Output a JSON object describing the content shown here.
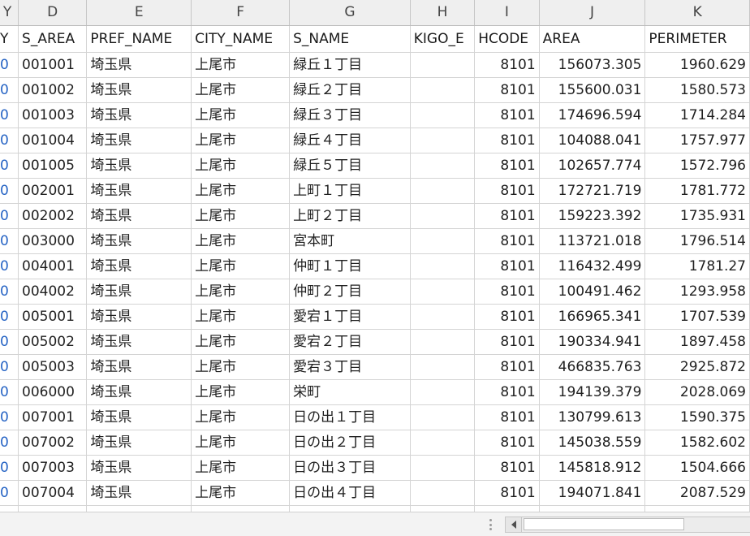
{
  "column_letters": [
    "Y",
    "D",
    "E",
    "F",
    "G",
    "H",
    "I",
    "J",
    "K"
  ],
  "field_headers": [
    "Y",
    "S_AREA",
    "PREF_NAME",
    "CITY_NAME",
    "S_NAME",
    "KIGO_E",
    "HCODE",
    "AREA",
    "PERIMETER"
  ],
  "rows": [
    {
      "lead": "0",
      "s_area": "001001",
      "pref": "埼玉県",
      "city": "上尾市",
      "s_name": "緑丘１丁目",
      "kigo_e": "",
      "hcode": "8101",
      "area": "156073.305",
      "perimeter": "1960.629"
    },
    {
      "lead": "0",
      "s_area": "001002",
      "pref": "埼玉県",
      "city": "上尾市",
      "s_name": "緑丘２丁目",
      "kigo_e": "",
      "hcode": "8101",
      "area": "155600.031",
      "perimeter": "1580.573"
    },
    {
      "lead": "0",
      "s_area": "001003",
      "pref": "埼玉県",
      "city": "上尾市",
      "s_name": "緑丘３丁目",
      "kigo_e": "",
      "hcode": "8101",
      "area": "174696.594",
      "perimeter": "1714.284"
    },
    {
      "lead": "0",
      "s_area": "001004",
      "pref": "埼玉県",
      "city": "上尾市",
      "s_name": "緑丘４丁目",
      "kigo_e": "",
      "hcode": "8101",
      "area": "104088.041",
      "perimeter": "1757.977"
    },
    {
      "lead": "0",
      "s_area": "001005",
      "pref": "埼玉県",
      "city": "上尾市",
      "s_name": "緑丘５丁目",
      "kigo_e": "",
      "hcode": "8101",
      "area": "102657.774",
      "perimeter": "1572.796"
    },
    {
      "lead": "0",
      "s_area": "002001",
      "pref": "埼玉県",
      "city": "上尾市",
      "s_name": "上町１丁目",
      "kigo_e": "",
      "hcode": "8101",
      "area": "172721.719",
      "perimeter": "1781.772"
    },
    {
      "lead": "0",
      "s_area": "002002",
      "pref": "埼玉県",
      "city": "上尾市",
      "s_name": "上町２丁目",
      "kigo_e": "",
      "hcode": "8101",
      "area": "159223.392",
      "perimeter": "1735.931"
    },
    {
      "lead": "0",
      "s_area": "003000",
      "pref": "埼玉県",
      "city": "上尾市",
      "s_name": "宮本町",
      "kigo_e": "",
      "hcode": "8101",
      "area": "113721.018",
      "perimeter": "1796.514"
    },
    {
      "lead": "0",
      "s_area": "004001",
      "pref": "埼玉県",
      "city": "上尾市",
      "s_name": "仲町１丁目",
      "kigo_e": "",
      "hcode": "8101",
      "area": "116432.499",
      "perimeter": "1781.27"
    },
    {
      "lead": "0",
      "s_area": "004002",
      "pref": "埼玉県",
      "city": "上尾市",
      "s_name": "仲町２丁目",
      "kigo_e": "",
      "hcode": "8101",
      "area": "100491.462",
      "perimeter": "1293.958"
    },
    {
      "lead": "0",
      "s_area": "005001",
      "pref": "埼玉県",
      "city": "上尾市",
      "s_name": "愛宕１丁目",
      "kigo_e": "",
      "hcode": "8101",
      "area": "166965.341",
      "perimeter": "1707.539"
    },
    {
      "lead": "0",
      "s_area": "005002",
      "pref": "埼玉県",
      "city": "上尾市",
      "s_name": "愛宕２丁目",
      "kigo_e": "",
      "hcode": "8101",
      "area": "190334.941",
      "perimeter": "1897.458"
    },
    {
      "lead": "0",
      "s_area": "005003",
      "pref": "埼玉県",
      "city": "上尾市",
      "s_name": "愛宕３丁目",
      "kigo_e": "",
      "hcode": "8101",
      "area": "466835.763",
      "perimeter": "2925.872"
    },
    {
      "lead": "0",
      "s_area": "006000",
      "pref": "埼玉県",
      "city": "上尾市",
      "s_name": "栄町",
      "kigo_e": "",
      "hcode": "8101",
      "area": "194139.379",
      "perimeter": "2028.069"
    },
    {
      "lead": "0",
      "s_area": "007001",
      "pref": "埼玉県",
      "city": "上尾市",
      "s_name": "日の出１丁目",
      "kigo_e": "",
      "hcode": "8101",
      "area": "130799.613",
      "perimeter": "1590.375"
    },
    {
      "lead": "0",
      "s_area": "007002",
      "pref": "埼玉県",
      "city": "上尾市",
      "s_name": "日の出２丁目",
      "kigo_e": "",
      "hcode": "8101",
      "area": "145038.559",
      "perimeter": "1582.602"
    },
    {
      "lead": "0",
      "s_area": "007003",
      "pref": "埼玉県",
      "city": "上尾市",
      "s_name": "日の出３丁目",
      "kigo_e": "",
      "hcode": "8101",
      "area": "145818.912",
      "perimeter": "1504.666"
    },
    {
      "lead": "0",
      "s_area": "007004",
      "pref": "埼玉県",
      "city": "上尾市",
      "s_name": "日の出４丁目",
      "kigo_e": "",
      "hcode": "8101",
      "area": "194071.841",
      "perimeter": "2087.529"
    }
  ],
  "row_keys": [
    "lead",
    "s_area",
    "pref",
    "city",
    "s_name",
    "kigo_e",
    "hcode",
    "area",
    "perimeter"
  ],
  "numeric_keys": [
    "hcode",
    "area",
    "perimeter"
  ],
  "colors": {
    "lead_digit": "#2563c4",
    "gridline": "#d4d4d4",
    "header_bg": "#efefef"
  }
}
